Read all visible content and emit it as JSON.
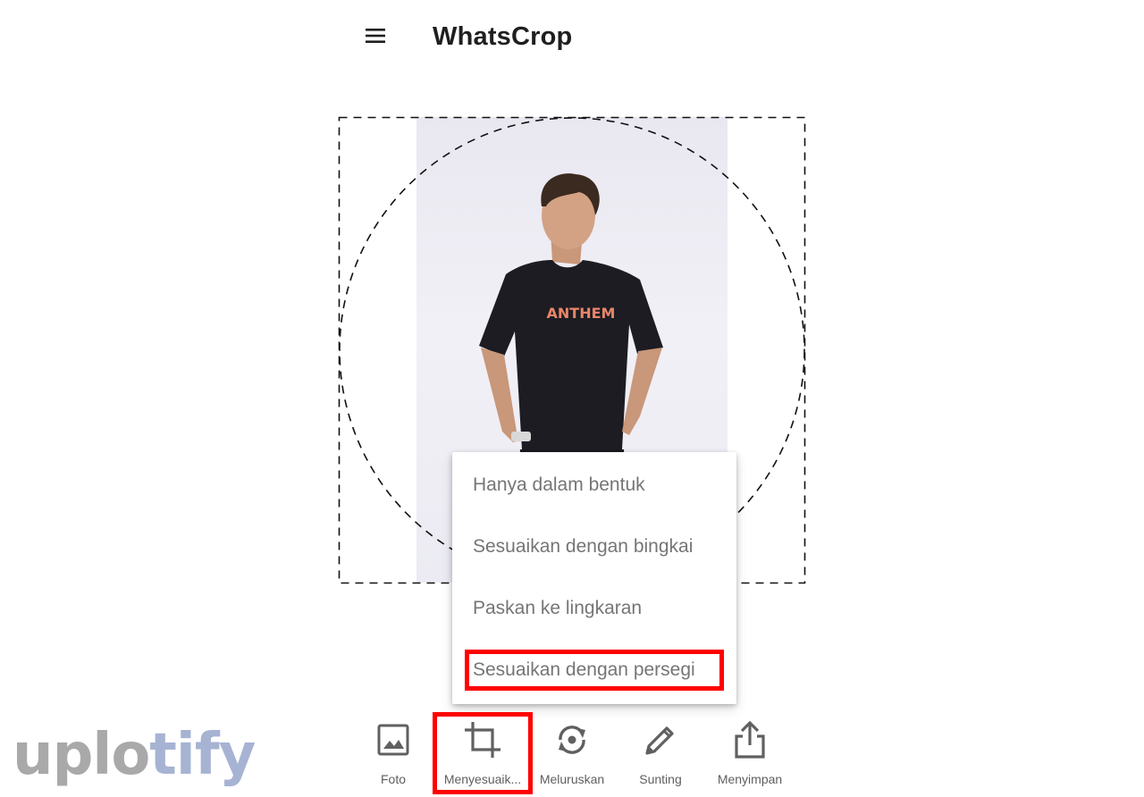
{
  "app": {
    "title": "WhatsCrop",
    "menu_icon": "hamburger-menu-icon"
  },
  "photo": {
    "shirt_text": "ANTHEM"
  },
  "crop_menu": {
    "items": [
      {
        "label": "Hanya dalam bentuk"
      },
      {
        "label": "Sesuaikan dengan bingkai"
      },
      {
        "label": "Paskan ke lingkaran"
      },
      {
        "label": "Sesuaikan dengan persegi",
        "highlighted": true
      }
    ]
  },
  "toolbar": {
    "items": [
      {
        "label": "Foto",
        "icon": "image-icon"
      },
      {
        "label": "Menyesuaik...",
        "icon": "crop-icon",
        "highlighted": true
      },
      {
        "label": "Meluruskan",
        "icon": "rotate-icon"
      },
      {
        "label": "Sunting",
        "icon": "pencil-icon"
      },
      {
        "label": "Menyimpan",
        "icon": "share-icon"
      }
    ]
  },
  "watermark": {
    "part1": "uplo",
    "part2": "tify"
  },
  "colors": {
    "highlight": "#ff0000",
    "menu_text": "#757575",
    "icon": "#606060"
  }
}
